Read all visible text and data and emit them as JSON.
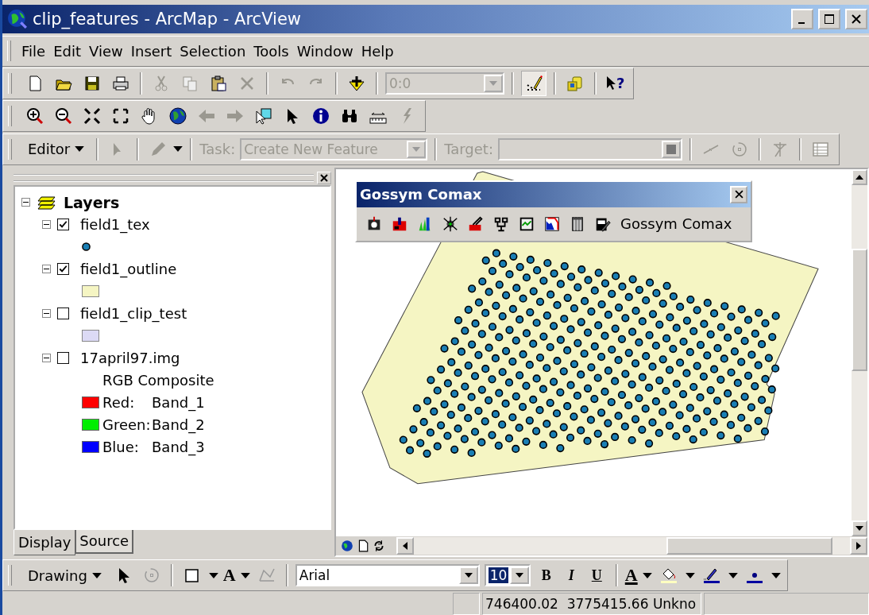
{
  "window": {
    "title": "clip_features - ArcMap - ArcView"
  },
  "menu": [
    "File",
    "Edit",
    "View",
    "Insert",
    "Selection",
    "Tools",
    "Window",
    "Help"
  ],
  "standard_toolbar": {
    "scale_value": "0:0",
    "scale_disabled": true,
    "help_mark": "?"
  },
  "editor_toolbar": {
    "label": "Editor",
    "task_label": "Task:",
    "task_value": "Create New Feature",
    "target_label": "Target:",
    "disabled": true
  },
  "table_of_contents": {
    "title": "Layers",
    "expanded": true,
    "layers": [
      {
        "name": "field1_tex",
        "checked": true,
        "expanded": true,
        "legend": {
          "kind": "point",
          "color": "#1a7fb5"
        }
      },
      {
        "name": "field1_outline",
        "checked": true,
        "expanded": true,
        "legend": {
          "kind": "fill",
          "color": "#f5f5c3"
        }
      },
      {
        "name": "field1_clip_test",
        "checked": false,
        "expanded": true,
        "legend": {
          "kind": "fill",
          "color": "#dcdaf5"
        }
      },
      {
        "name": "17april97.img",
        "checked": false,
        "expanded": true,
        "legend": {
          "kind": "raster",
          "title": "RGB Composite",
          "bands": [
            {
              "channel": "Red:",
              "band": "Band_1",
              "color": "#ff0000"
            },
            {
              "channel": "Green:",
              "band": "Band_2",
              "color": "#00ee00"
            },
            {
              "channel": "Blue:",
              "band": "Band_3",
              "color": "#0000ff"
            }
          ]
        }
      }
    ]
  },
  "toc_tabs": [
    {
      "label": "Display",
      "selected": true
    },
    {
      "label": "Source",
      "selected": false
    }
  ],
  "floating_toolbar": {
    "title": "Gossym Comax",
    "button_label": "Gossym Comax"
  },
  "drawing_toolbar": {
    "label": "Drawing",
    "text_tool": "A",
    "font": "Arial",
    "font_size": "10",
    "styles": [
      "B",
      "I",
      "U"
    ],
    "font_color": "A"
  },
  "status_bar": {
    "coordinates": "746400.02  3775415.66 Unkno"
  }
}
